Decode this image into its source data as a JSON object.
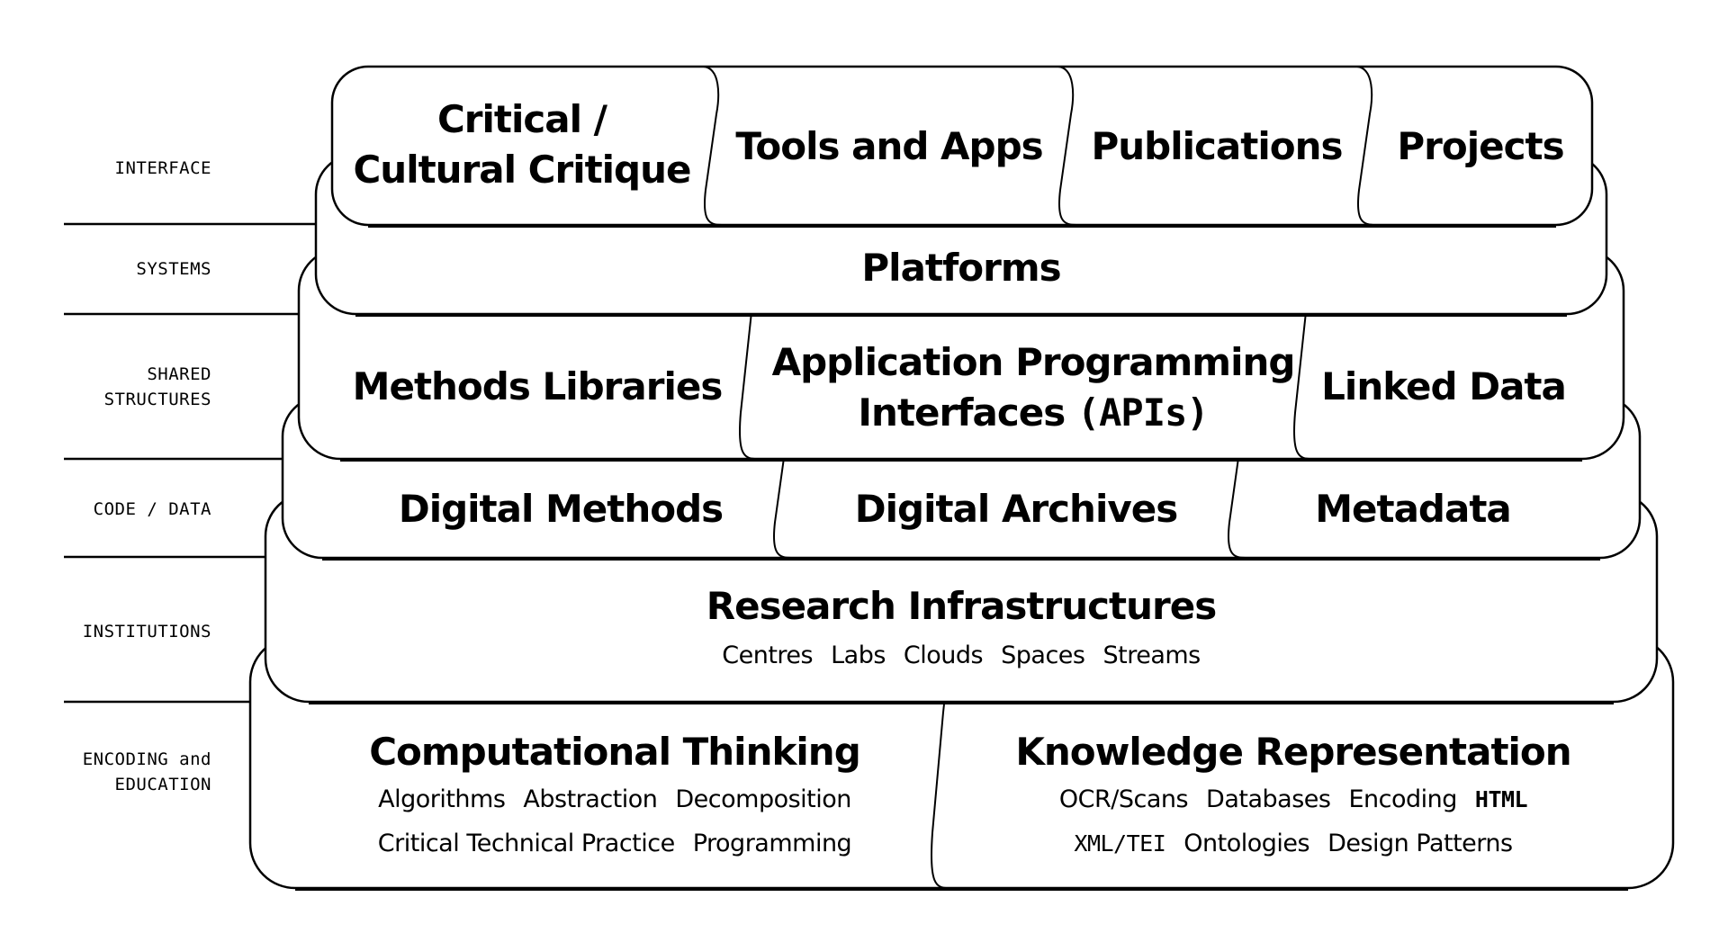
{
  "diagram": {
    "type": "layered-stack",
    "line_color": "#000000",
    "background": "#ffffff",
    "layers": [
      {
        "label": [
          "INTERFACE"
        ],
        "cells": [
          {
            "title": [
              "Critical /",
              "Cultural Critique"
            ]
          },
          {
            "title": [
              "Tools and Apps"
            ]
          },
          {
            "title": [
              "Publications"
            ]
          },
          {
            "title": [
              "Projects"
            ]
          }
        ]
      },
      {
        "label": [
          "SYSTEMS"
        ],
        "cells": [
          {
            "title": [
              "Platforms"
            ]
          }
        ]
      },
      {
        "label": [
          "SHARED",
          "STRUCTURES"
        ],
        "cells": [
          {
            "title": [
              "Methods Libraries"
            ]
          },
          {
            "title": [
              "Application Programming",
              "Interfaces"
            ],
            "title_suffix": "(APIs)"
          },
          {
            "title": [
              "Linked Data"
            ]
          }
        ]
      },
      {
        "label": [
          "CODE / DATA"
        ],
        "cells": [
          {
            "title": [
              "Digital Methods"
            ]
          },
          {
            "title": [
              "Digital Archives"
            ]
          },
          {
            "title": [
              "Metadata"
            ]
          }
        ]
      },
      {
        "label": [
          "INSTITUTIONS"
        ],
        "cells": [
          {
            "title": [
              "Research Infrastructures"
            ],
            "items": [
              [
                "Centres",
                "Labs",
                "Clouds",
                "Spaces",
                "Streams"
              ]
            ]
          }
        ]
      },
      {
        "label": [
          "ENCODING and",
          "EDUCATION"
        ],
        "cells": [
          {
            "title": [
              "Computational Thinking"
            ],
            "items": [
              [
                "Algorithms",
                "Abstraction",
                "Decomposition"
              ],
              [
                "Critical Technical Practice",
                "Programming"
              ]
            ]
          },
          {
            "title": [
              "Knowledge Representation"
            ],
            "items": [
              [
                "OCR/Scans",
                "Databases",
                "Encoding",
                "HTML"
              ],
              [
                "XML/TEI",
                "Ontologies",
                "Design Patterns"
              ]
            ]
          }
        ]
      }
    ]
  }
}
